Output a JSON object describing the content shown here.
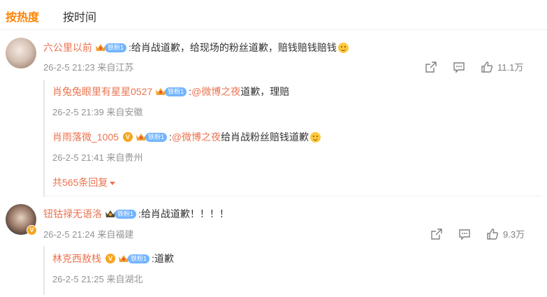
{
  "tabs": {
    "hot": "按热度",
    "time": "按时间"
  },
  "badge_label": "铁粉1",
  "comments": [
    {
      "user": "六公里以前",
      "prefix": ":",
      "text": "给肖战道歉，给现场的粉丝道歉，赔钱赔钱赔钱",
      "emoji": "smile-emoji",
      "time": "26-2-5 21:23 来自江苏",
      "likes": "11.1万",
      "replies": [
        {
          "user": "肖兔兔眼里有星星0527",
          "prefix": ":",
          "mention": "@微博之夜",
          "text": " 道歉，理赔",
          "time": "26-2-5 21:39 来自安徽"
        },
        {
          "user": "肖雨落微_1005",
          "prefix": ":",
          "mention": "@微博之夜",
          "text": " 给肖战粉丝赔钱道歉",
          "time": "26-2-5 21:41 来自贵州"
        }
      ],
      "more": "共565条回复"
    },
    {
      "user": "钮钴禄无语洛",
      "prefix": ":",
      "text": "给肖战道歉！！！！",
      "time": "26-2-5 21:24 来自福建",
      "likes": "9.3万",
      "replies": [
        {
          "user": "林克西敖栈",
          "prefix": ":",
          "text": "道歉",
          "time": "26-2-5 21:25 来自湖北"
        }
      ]
    }
  ],
  "colors": {
    "accent": "#ff8200",
    "name": "#eb7350",
    "meta": "#939393",
    "fan_badge": "#73b4ff",
    "verified": "#f5a623"
  }
}
